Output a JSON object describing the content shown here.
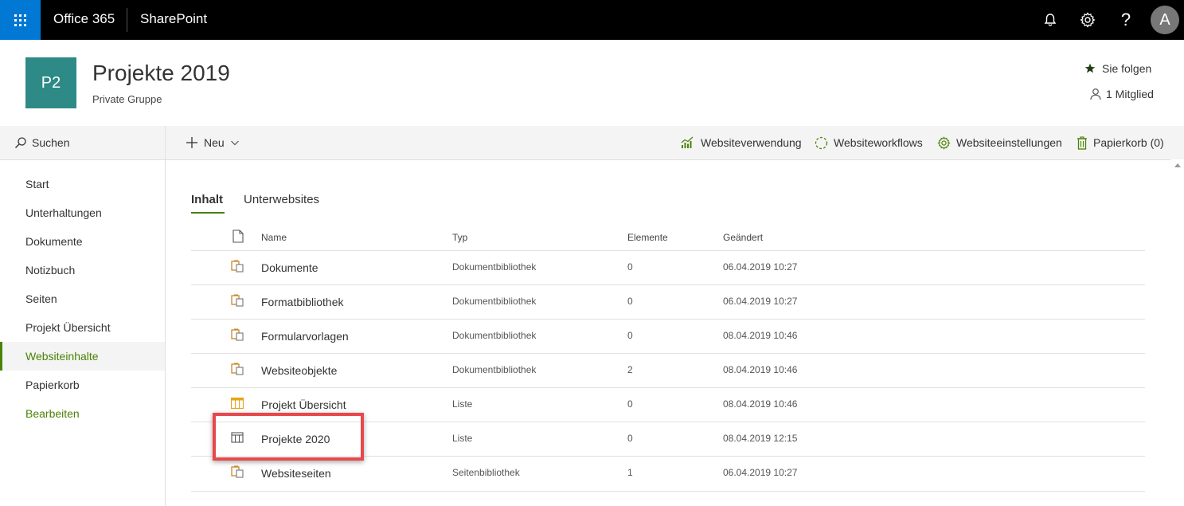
{
  "topbar": {
    "brand": "Office 365",
    "app": "SharePoint",
    "avatar_letter": "A",
    "help_glyph": "?"
  },
  "site": {
    "logo": "P2",
    "title": "Projekte 2019",
    "subtitle": "Private Gruppe",
    "follow_label": "Sie folgen",
    "members_label": "1 Mitglied"
  },
  "leftnav": {
    "search_label": "Suchen",
    "items": [
      {
        "label": "Start"
      },
      {
        "label": "Unterhaltungen"
      },
      {
        "label": "Dokumente"
      },
      {
        "label": "Notizbuch"
      },
      {
        "label": "Seiten"
      },
      {
        "label": "Projekt Übersicht"
      },
      {
        "label": "Websiteinhalte"
      },
      {
        "label": "Papierkorb"
      }
    ],
    "edit_label": "Bearbeiten"
  },
  "commandbar": {
    "new_label": "Neu",
    "usage": "Websiteverwendung",
    "workflows": "Websiteworkflows",
    "settings": "Websiteeinstellungen",
    "recycle": "Papierkorb (0)"
  },
  "tabs": {
    "content": "Inhalt",
    "subsites": "Unterwebsites"
  },
  "table": {
    "headers": {
      "name": "Name",
      "type": "Typ",
      "count": "Elemente",
      "modified": "Geändert"
    },
    "rows": [
      {
        "name": "Dokumente",
        "type": "Dokumentbibliothek",
        "count": "0",
        "modified": "06.04.2019 10:27",
        "icon": "library-icon"
      },
      {
        "name": "Formatbibliothek",
        "type": "Dokumentbibliothek",
        "count": "0",
        "modified": "06.04.2019 10:27",
        "icon": "library-icon"
      },
      {
        "name": "Formularvorlagen",
        "type": "Dokumentbibliothek",
        "count": "0",
        "modified": "08.04.2019 10:46",
        "icon": "library-icon"
      },
      {
        "name": "Websiteobjekte",
        "type": "Dokumentbibliothek",
        "count": "2",
        "modified": "08.04.2019 10:46",
        "icon": "library-icon"
      },
      {
        "name": "Projekt Übersicht",
        "type": "Liste",
        "count": "0",
        "modified": "08.04.2019 10:46",
        "icon": "list-icon"
      },
      {
        "name": "Projekte 2020",
        "type": "Liste",
        "count": "0",
        "modified": "08.04.2019 12:15",
        "icon": "list-outline-icon"
      },
      {
        "name": "Websiteseiten",
        "type": "Seitenbibliothek",
        "count": "1",
        "modified": "06.04.2019 10:27",
        "icon": "library-icon"
      }
    ]
  },
  "colors": {
    "accent_green": "#498205",
    "waffle_blue": "#0078d4",
    "site_logo": "#2e8a87",
    "highlight": "#e8484c"
  }
}
